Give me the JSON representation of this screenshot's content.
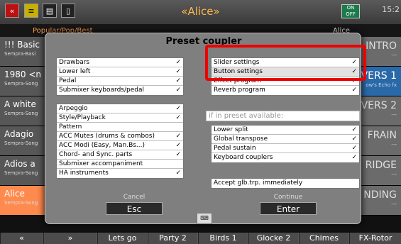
{
  "topbar": {
    "title": "«Alice»",
    "clock": "15:2",
    "toggle_label": "ON\nOFF"
  },
  "header": {
    "left": "Popular/Pop/Best",
    "right": "Alice"
  },
  "left_items": [
    {
      "name": "!!! Basic",
      "sub": "Sempra-Basi"
    },
    {
      "name": "1980 <n",
      "sub": "Sempra-Song"
    },
    {
      "name": "A white",
      "sub": "Sempra-Song"
    },
    {
      "name": "Adagio",
      "sub": "Sempra-Song"
    },
    {
      "name": "Adios a",
      "sub": "Sempra-Song"
    },
    {
      "name": "Alice",
      "sub": "Sempra-Song"
    }
  ],
  "right_items": [
    {
      "name": "INTRO",
      "sub": "---"
    },
    {
      "name": "VERS 1",
      "sub": "ow's Echo fx"
    },
    {
      "name": "VERS 2",
      "sub": "---"
    },
    {
      "name": "FRAIN",
      "sub": "---"
    },
    {
      "name": "RIDGE",
      "sub": "---"
    },
    {
      "name": "NDING",
      "sub": "---"
    }
  ],
  "bottom": {
    "up": "«",
    "down": "»",
    "buttons": [
      "Lets go",
      "Party 2",
      "Birds 1",
      "Glocke 2",
      "Chimes",
      "FX-Rotor"
    ]
  },
  "dialog": {
    "title": "Preset coupler",
    "box1": [
      [
        "Drawbars",
        "✓"
      ],
      [
        "Lower left",
        "✓"
      ],
      [
        "Pedal",
        "✓"
      ],
      [
        "Submixer keyboards/pedal",
        "✓"
      ]
    ],
    "box2": [
      [
        "Arpeggio",
        "✓"
      ],
      [
        "Style/Playback",
        "✓"
      ],
      [
        "Pattern",
        ""
      ],
      [
        "ACC Mutes (drums & combos)",
        "✓"
      ],
      [
        "ACC Modi (Easy, Man.Bs...)",
        "✓"
      ],
      [
        "Chord- and Sync. parts",
        "✓"
      ],
      [
        "Submixer accompaniment",
        ""
      ],
      [
        "HA instruments",
        "✓"
      ]
    ],
    "box3": [
      [
        "Slider settings",
        "✓"
      ],
      [
        "Button settings",
        "✓"
      ],
      [
        "Effect program",
        "✓"
      ],
      [
        "Reverb program",
        "✓"
      ]
    ],
    "if_label": "if in preset available:",
    "box4": [
      [
        "Lower split",
        "✓"
      ],
      [
        "Global transpose",
        "✓"
      ],
      [
        "Pedal sustain",
        "✓"
      ],
      [
        "Keyboard couplers",
        "✓"
      ]
    ],
    "box5": [
      [
        "Accept glb.trp. immediately",
        ""
      ]
    ],
    "cancel_label": "Cancel",
    "cancel_key": "Esc",
    "continue_label": "Continue",
    "continue_key": "Enter",
    "keyboard_icon": "keyboard-icon"
  }
}
